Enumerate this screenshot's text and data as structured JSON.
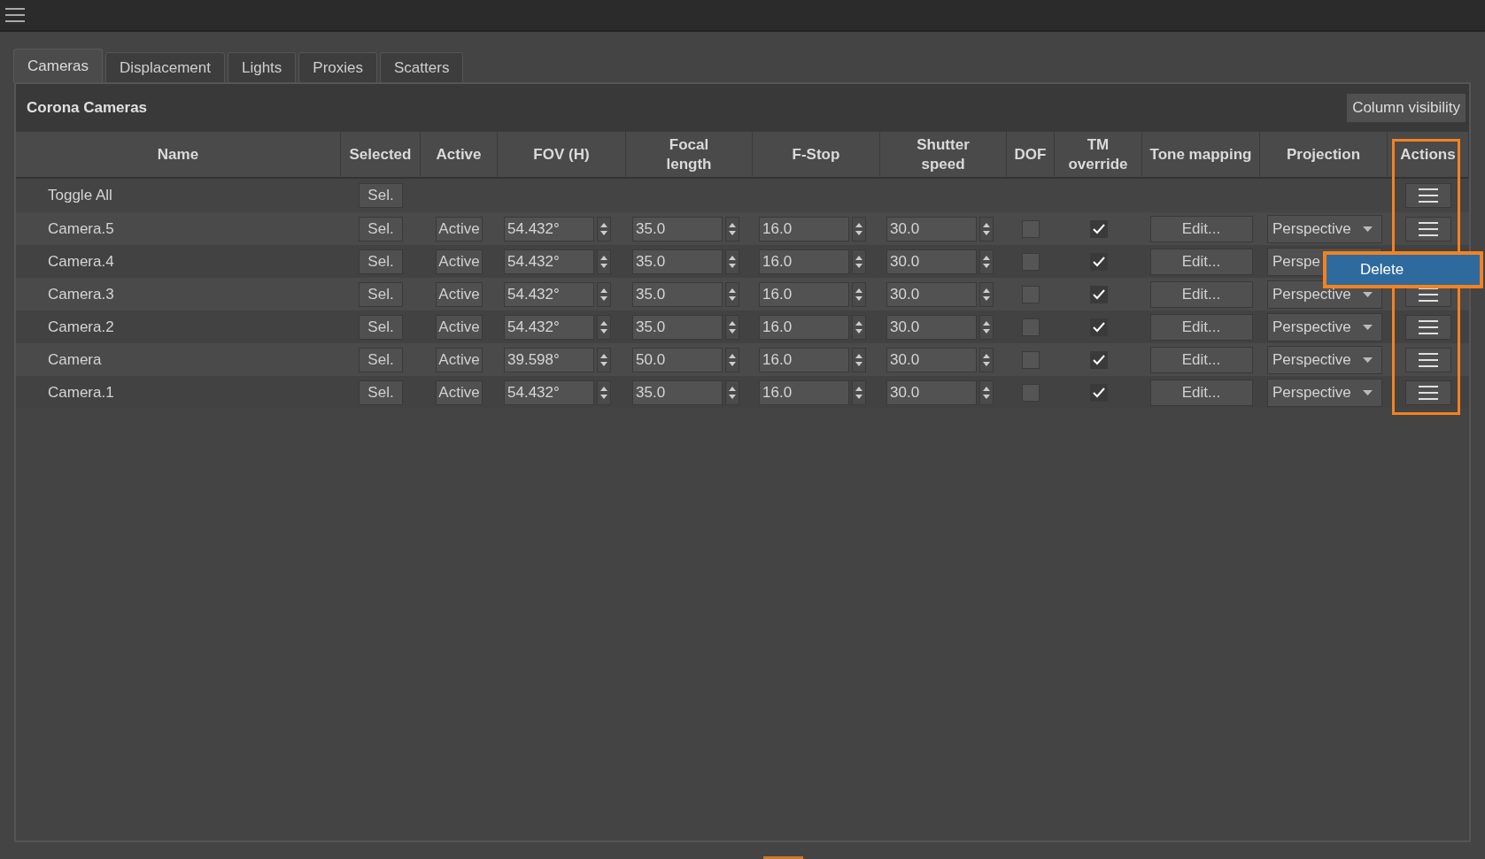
{
  "tabs": [
    {
      "label": "Cameras",
      "selected": true
    },
    {
      "label": "Displacement",
      "selected": false
    },
    {
      "label": "Lights",
      "selected": false
    },
    {
      "label": "Proxies",
      "selected": false
    },
    {
      "label": "Scatters",
      "selected": false
    }
  ],
  "panel": {
    "title": "Corona Cameras",
    "column_visibility_button": "Column visibility"
  },
  "table": {
    "columns": [
      "Name",
      "Selected",
      "Active",
      "FOV (H)",
      "Focal length",
      "F-Stop",
      "Shutter speed",
      "DOF",
      "TM override",
      "Tone mapping",
      "Projection",
      "Actions"
    ],
    "toggle_row": {
      "label": "Toggle All",
      "sel_button": "Sel."
    },
    "rows": [
      {
        "name": "Camera.5",
        "sel_button": "Sel.",
        "active": "Active",
        "fov": "54.432°",
        "focal_length": "35.0",
        "f_stop": "16.0",
        "shutter_speed": "30.0",
        "dof": false,
        "tm_override": true,
        "tone_mapping": "Edit...",
        "projection": "Perspective",
        "caret": true,
        "actions_button": true
      },
      {
        "name": "Camera.4",
        "sel_button": "Sel.",
        "active": "Active",
        "fov": "54.432°",
        "focal_length": "35.0",
        "f_stop": "16.0",
        "shutter_speed": "30.0",
        "dof": false,
        "tm_override": true,
        "tone_mapping": "Edit...",
        "projection": "Perspe",
        "caret": false,
        "actions_button": false
      },
      {
        "name": "Camera.3",
        "sel_button": "Sel.",
        "active": "Active",
        "fov": "54.432°",
        "focal_length": "35.0",
        "f_stop": "16.0",
        "shutter_speed": "30.0",
        "dof": false,
        "tm_override": true,
        "tone_mapping": "Edit...",
        "projection": "Perspective",
        "caret": true,
        "actions_button": true
      },
      {
        "name": "Camera.2",
        "sel_button": "Sel.",
        "active": "Active",
        "fov": "54.432°",
        "focal_length": "35.0",
        "f_stop": "16.0",
        "shutter_speed": "30.0",
        "dof": false,
        "tm_override": true,
        "tone_mapping": "Edit...",
        "projection": "Perspective",
        "caret": true,
        "actions_button": true
      },
      {
        "name": "Camera",
        "sel_button": "Sel.",
        "active": "Active",
        "fov": "39.598°",
        "focal_length": "50.0",
        "f_stop": "16.0",
        "shutter_speed": "30.0",
        "dof": false,
        "tm_override": true,
        "tone_mapping": "Edit...",
        "projection": "Perspective",
        "caret": true,
        "actions_button": true
      },
      {
        "name": "Camera.1",
        "sel_button": "Sel.",
        "active": "Active",
        "fov": "54.432°",
        "focal_length": "35.0",
        "f_stop": "16.0",
        "shutter_speed": "30.0",
        "dof": false,
        "tm_override": true,
        "tone_mapping": "Edit...",
        "projection": "Perspective",
        "caret": true,
        "actions_button": true
      }
    ]
  },
  "context_menu": {
    "items": [
      {
        "label": "Delete",
        "selected": true
      }
    ]
  }
}
